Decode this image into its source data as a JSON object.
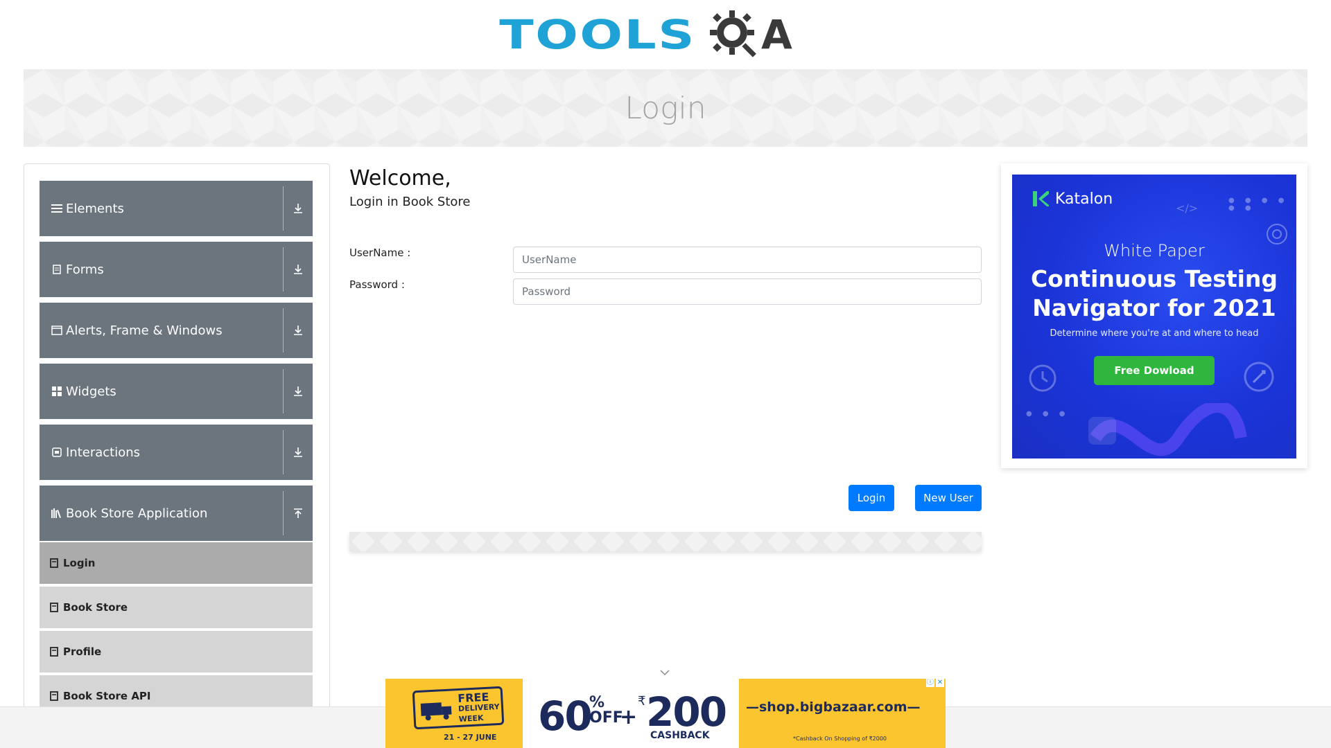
{
  "logo": {
    "tools": "TOOLS",
    "a": "A"
  },
  "banner": {
    "title": "Login"
  },
  "sidebar": {
    "groups": [
      {
        "label": "Elements",
        "icon": "hamburger-icon"
      },
      {
        "label": "Forms",
        "icon": "form-icon"
      },
      {
        "label": "Alerts, Frame & Windows",
        "icon": "window-icon"
      },
      {
        "label": "Widgets",
        "icon": "widgets-icon"
      },
      {
        "label": "Interactions",
        "icon": "interactions-icon"
      },
      {
        "label": "Book Store Application",
        "icon": "books-icon"
      }
    ],
    "items": [
      {
        "label": "Login",
        "active": true
      },
      {
        "label": "Book Store"
      },
      {
        "label": "Profile"
      },
      {
        "label": "Book Store API"
      }
    ]
  },
  "main": {
    "welcome": "Welcome,",
    "subtitle": "Login in Book Store",
    "username_label": "UserName :",
    "username_placeholder": "UserName",
    "password_label": "Password :",
    "password_placeholder": "Password",
    "login_button": "Login",
    "new_user_button": "New User"
  },
  "ad_right": {
    "brand": "Katalon",
    "white_paper": "White Paper",
    "headline_1": "Continuous Testing",
    "headline_2": "Navigator for 2021",
    "desc": "Determine where you're at and where to head",
    "cta": "Free Dowload",
    "accent": "#1b34d8",
    "cta_color": "#2fb63c"
  },
  "ad_bottom": {
    "free_delivery": "FREE\nDELIVERY\nWEEK",
    "dates": "21 - 27 JUNE",
    "sixty": "60",
    "percent": "%",
    "off": "OFF",
    "plus": "+",
    "rupee": "₹",
    "amount": "200",
    "cashback": "CASHBACK",
    "shop": "—shop.bigbazaar.com—",
    "note": "*Cashback On Shopping of ₹2000",
    "bg_color": "#fbc52f"
  }
}
